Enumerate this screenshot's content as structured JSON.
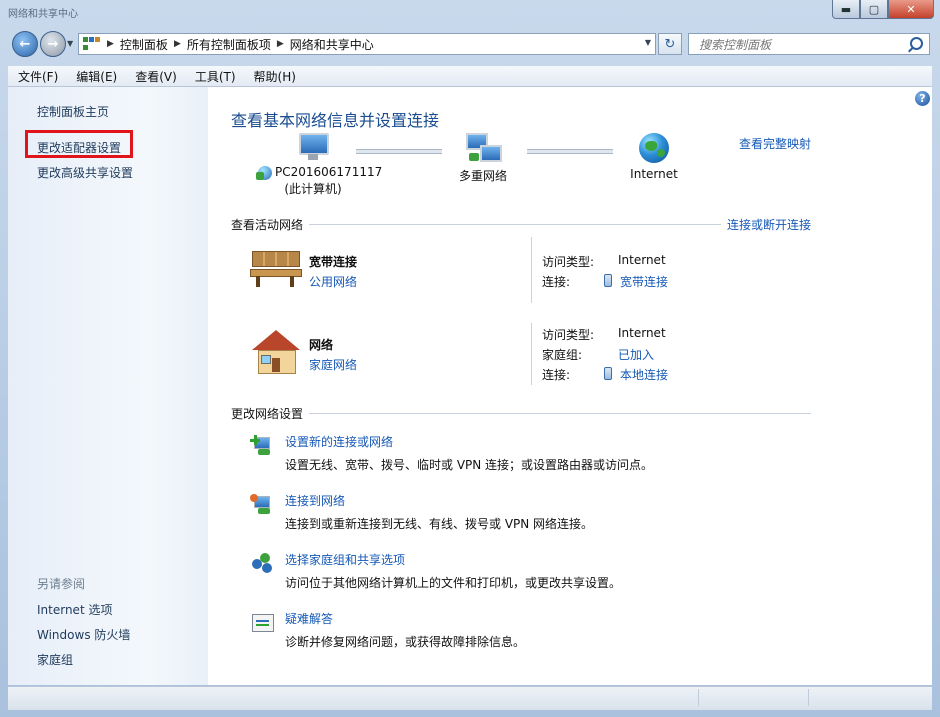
{
  "window": {
    "title": "网络和共享中心",
    "minimize_glyph": "▬",
    "maximize_glyph": "▢",
    "close_glyph": "✕"
  },
  "nav": {
    "back_glyph": "←",
    "forward_glyph": "→",
    "breadcrumbs": [
      "控制面板",
      "所有控制面板项",
      "网络和共享中心"
    ],
    "refresh_glyph": "↻",
    "search_placeholder": "搜索控制面板"
  },
  "menubar": {
    "items": [
      "文件(F)",
      "编辑(E)",
      "查看(V)",
      "工具(T)",
      "帮助(H)"
    ]
  },
  "sidebar": {
    "items": [
      "控制面板主页",
      "更改适配器设置",
      "更改高级共享设置"
    ],
    "highlighted_item": "更改适配器设置",
    "see_also_heading": "另请参阅",
    "see_also_items": [
      "Internet 选项",
      "Windows 防火墙",
      "家庭组"
    ]
  },
  "main": {
    "title": "查看基本网络信息并设置连接",
    "view_full_map_link": "查看完整映射",
    "map": {
      "computer_name": "PC201606171117",
      "computer_sub": "(此计算机)",
      "middle_label": "多重网络",
      "internet_label": "Internet"
    },
    "active_networks": {
      "heading": "查看活动网络",
      "action_link": "连接或断开连接",
      "networks": [
        {
          "name": "宽带连接",
          "type": "公用网络",
          "icon": "bench-icon",
          "details": [
            {
              "label": "访问类型:",
              "value": "Internet",
              "is_link": false
            },
            {
              "label": "连接:",
              "value": "宽带连接",
              "is_link": true
            }
          ]
        },
        {
          "name": "网络",
          "type": "家庭网络",
          "icon": "house-icon",
          "details": [
            {
              "label": "访问类型:",
              "value": "Internet",
              "is_link": false
            },
            {
              "label": "家庭组:",
              "value": "已加入",
              "is_link": true
            },
            {
              "label": "连接:",
              "value": "本地连接",
              "is_link": true
            }
          ]
        }
      ]
    },
    "change_settings": {
      "heading": "更改网络设置",
      "tasks": [
        {
          "title": "设置新的连接或网络",
          "desc": "设置无线、宽带、拨号、临时或 VPN 连接；或设置路由器或访问点。",
          "icon": "new-connection-icon"
        },
        {
          "title": "连接到网络",
          "desc": "连接到或重新连接到无线、有线、拨号或 VPN 网络连接。",
          "icon": "connect-network-icon"
        },
        {
          "title": "选择家庭组和共享选项",
          "desc": "访问位于其他网络计算机上的文件和打印机，或更改共享设置。",
          "icon": "homegroup-icon"
        },
        {
          "title": "疑难解答",
          "desc": "诊断并修复网络问题，或获得故障排除信息。",
          "icon": "troubleshoot-icon"
        }
      ]
    },
    "help_glyph": "?"
  }
}
